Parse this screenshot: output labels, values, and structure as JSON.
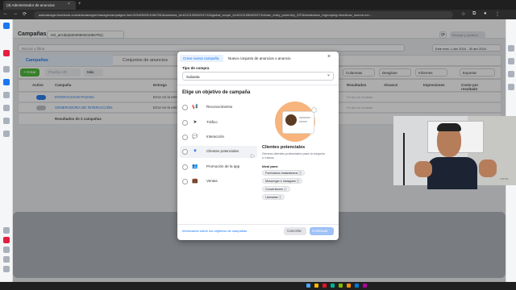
{
  "browser": {
    "tab_title": "(3) Administrador de anuncios",
    "tab_close": "×",
    "new_tab": "+",
    "url": "adsmanager.facebook.com/adsmanager/manage/campaigns?act=5204050321084781&business_id=611210506224741&global_scope_id=611210506224741&nav_entry_point=lep_237&breakdown_regrouping=true&nav_source=un..."
  },
  "header": {
    "title": "Campañas",
    "account": "HS_arroba(5204050321084781)",
    "review_button": "Revisar y publicar",
    "search_placeholder": "Buscar y filtrar",
    "date_range": "Este mes: 1 abr 2024 - 30 abr 2024"
  },
  "tabs": {
    "campaigns": "Campañas",
    "adsets": "Conjuntos de anuncios"
  },
  "toolbar": {
    "create": "+ Crear",
    "duplicate": "Prueba A/B",
    "more": "Más",
    "columns": "Columnas",
    "breakdowns": "Desglose",
    "reports": "Informes",
    "export": "Exportar"
  },
  "table": {
    "headers": [
      "Activo",
      "Campaña",
      "Entrega",
      "Resultados",
      "Alcance",
      "Impresiones",
      "Costo por resultado"
    ],
    "rows": [
      {
        "name": "INTERACCION PAGINA",
        "status": "Error en la entrega",
        "muted": "Por tipo de resultado"
      },
      {
        "name": "GENERADORA DE INTERACCIÓN",
        "status": "Error en la entrega",
        "muted": "Por tipo de resultado"
      }
    ],
    "summary": "Resultados de 2 campañas"
  },
  "modal": {
    "tab_new": "Crear nueva campaña",
    "tab_adset": "Nuevo conjunto de anuncios o anuncio",
    "close": "×",
    "buy_type_label": "Tipo de compra",
    "buy_type_value": "Subasta",
    "objective_label": "Elige un objetivo de campaña",
    "options": [
      {
        "label": "Reconocimiento",
        "icon": "megaphone-icon",
        "glyph": "📢"
      },
      {
        "label": "Tráfico",
        "icon": "cursor-icon",
        "glyph": "➤"
      },
      {
        "label": "Interacción",
        "icon": "chat-icon",
        "glyph": "💬"
      },
      {
        "label": "Clientes potenciales",
        "icon": "funnel-icon",
        "glyph": "▼"
      },
      {
        "label": "Promoción de la app",
        "icon": "people-icon",
        "glyph": "👥"
      },
      {
        "label": "Ventas",
        "icon": "briefcase-icon",
        "glyph": "💼"
      }
    ],
    "selected_title": "Clientes potenciales",
    "selected_desc": "Genera clientes potenciales para tu negocio o marca.",
    "ideal_label": "Ideal para:",
    "ideal_pills": [
      "Formularios instantáneos",
      "Messenger e Instagram",
      "Conversiones",
      "Llamadas"
    ],
    "info_link": "Información sobre los objetivos de campañas",
    "cancel": "Cancelar",
    "continue": "Continuar"
  },
  "webcam": {
    "brand": "udemy"
  },
  "colors": {
    "accent": "#1877f2",
    "create_green": "#42b72a"
  }
}
